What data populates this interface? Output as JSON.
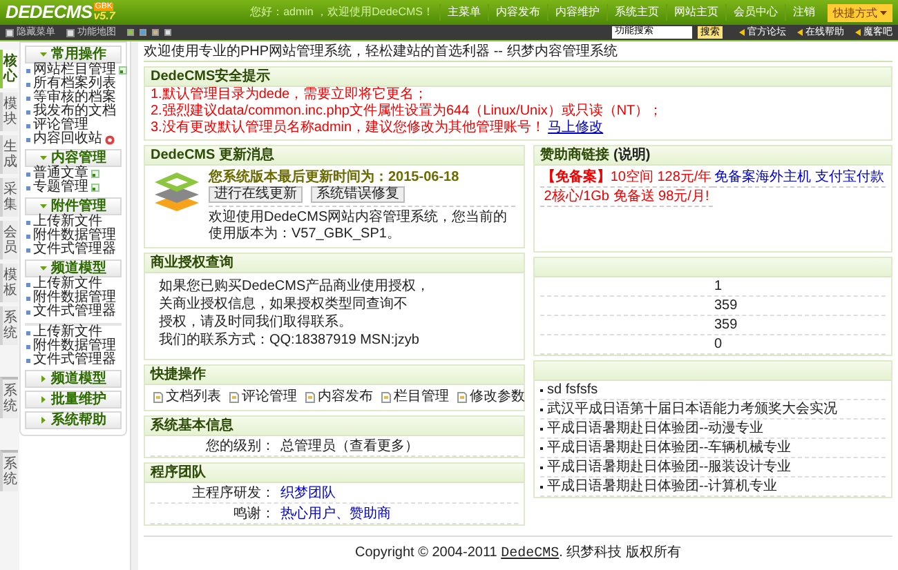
{
  "header": {
    "logo": "DEDECMS",
    "version": "v5.7",
    "edition": "GBK",
    "greeting": "您好：admin ，欢迎使用DedeCMS！",
    "nav": [
      "主菜单",
      "内容发布",
      "内容维护",
      "系统主页",
      "网站主页",
      "会员中心",
      "注销"
    ],
    "shortcut": "快捷方式"
  },
  "toolbar": {
    "hide_menu": "隐藏菜单",
    "feature_map": "功能地图",
    "skins": [
      {
        "color": "#8cc63f"
      },
      {
        "color": "#4fa3dc"
      },
      {
        "color": "#c9b48a"
      },
      {
        "color": "#e0e0e0"
      }
    ],
    "search": {
      "value": "功能搜索",
      "button": "搜索"
    },
    "links": [
      "官方论坛",
      "在线帮助",
      "魔客吧"
    ]
  },
  "side_tabs": [
    {
      "label": "核心",
      "selected": true,
      "separated": false
    },
    {
      "label": "模块",
      "selected": false,
      "separated": false
    },
    {
      "label": "生成",
      "selected": false,
      "separated": false
    },
    {
      "label": "采集",
      "selected": false,
      "separated": false
    },
    {
      "label": "会员",
      "selected": false,
      "separated": false
    },
    {
      "label": "模板",
      "selected": false,
      "separated": false
    },
    {
      "label": "系统",
      "selected": false,
      "separated": false
    },
    {
      "label": "系统",
      "selected": false,
      "separated": true
    },
    {
      "label": "系统",
      "selected": false,
      "separated": true
    }
  ],
  "menu": [
    {
      "title": "常用操作",
      "expanded": true,
      "items": [
        {
          "label": "网站栏目管理",
          "kind": "add"
        },
        {
          "label": "所有档案列表",
          "kind": "plain"
        },
        {
          "label": "等审核的档案",
          "kind": "plain"
        },
        {
          "label": "我发布的文档",
          "kind": "plain"
        },
        {
          "label": "评论管理",
          "kind": "plain"
        },
        {
          "label": "内容回收站",
          "kind": "trash"
        }
      ]
    },
    {
      "title": "内容管理",
      "expanded": true,
      "items": [
        {
          "label": "普通文章",
          "kind": "add"
        },
        {
          "label": "专题管理",
          "kind": "add"
        }
      ]
    },
    {
      "title": "附件管理",
      "expanded": true,
      "items": [
        {
          "label": "上传新文件",
          "kind": "plain"
        },
        {
          "label": "附件数据管理",
          "kind": "plain"
        },
        {
          "label": "文件式管理器",
          "kind": "plain"
        }
      ]
    },
    {
      "title": "频道模型",
      "expanded": true,
      "items": [
        {
          "label": "上传新文件",
          "kind": "plain"
        },
        {
          "label": "附件数据管理",
          "kind": "plain"
        },
        {
          "label": "文件式管理器",
          "kind": "plain"
        }
      ]
    },
    {
      "expanded": true,
      "items": [
        {
          "label": "上传新文件",
          "kind": "plain"
        },
        {
          "label": "附件数据管理",
          "kind": "plain"
        },
        {
          "label": "文件式管理器",
          "kind": "plain"
        }
      ]
    },
    {
      "title": "频道模型",
      "expanded": false
    },
    {
      "title": "批量维护",
      "expanded": false
    },
    {
      "title": "系统帮助",
      "expanded": false
    }
  ],
  "welcome": "欢迎使用专业的PHP网站管理系统，轻松建站的首选利器 -- 织梦内容管理系统",
  "security": {
    "title": "DedeCMS安全提示",
    "lines": [
      {
        "text": "1.默认管理目录为dede，需要立即将它更名；"
      },
      {
        "text": "2.强烈建议data/common.inc.php文件属性设置为644（Linux/Unix）或只读（NT）；"
      },
      {
        "text": "3.没有更改默认管理员名称admin，建议您修改为其他管理账号！",
        "link": "马上修改"
      }
    ]
  },
  "update": {
    "title": "DedeCMS 更新消息",
    "heading": "您系统版本最后更新时间为：2015-06-18",
    "buttons": [
      "进行在线更新",
      "系统错误修复"
    ],
    "text": "欢迎使用DedeCMS网站内容管理系统，您当前的使用版本为：V57_GBK_SP1。"
  },
  "license": {
    "title": "商业授权查询",
    "lines": [
      "如果您已购买DedeCMS产品商业使用授权，",
      "关商业授权信息，如果授权类型同查询不",
      "授权，请及时同我们取得联系。",
      "我们的联系方式：QQ:18387919 MSN:jzyb"
    ]
  },
  "quick": {
    "title": "快捷操作",
    "items": [
      "文档列表",
      "评论管理",
      "内容发布",
      "栏目管理",
      "修改参数"
    ]
  },
  "sysinfo": {
    "title": "系统基本信息",
    "rows": [
      {
        "label": "您的级别：",
        "value": "总管理员（查看更多）",
        "link": false
      }
    ]
  },
  "team": {
    "title": "程序团队",
    "rows": [
      {
        "label": "主程序研发：",
        "value": "织梦团队",
        "link": true
      },
      {
        "label": "鸣谢：",
        "value": "热心用户、赞助商",
        "link": true
      }
    ]
  },
  "sponsor": {
    "title": "赞助商链接",
    "note": "(说明)",
    "rows": [
      [
        {
          "text": "【免备案】",
          "color": "#ee0000",
          "bold": true
        },
        {
          "text": "10空间 128元/年",
          "color": "#ee0000",
          "bold": false
        },
        {
          "text": "免备案海外主机 支付宝付款",
          "color": "#0000cc",
          "bold": false
        }
      ],
      [
        {
          "text": "2核心/1Gb 免备送 98元/月!",
          "color": "#ee0000",
          "bold": false
        }
      ]
    ]
  },
  "stats": {
    "values": [
      "1",
      "359",
      "359",
      "0"
    ]
  },
  "news": {
    "items": [
      "sd fsfsfs",
      "武汉平成日语第十届日本语能力考颁奖大会实况",
      "平成日语暑期赴日体验团--动漫专业",
      "平成日语暑期赴日体验团--车辆机械专业",
      "平成日语暑期赴日体验团--服装设计专业",
      "平成日语暑期赴日体验团--计算机专业"
    ]
  },
  "footer": {
    "prefix": "Copyright © 2004-2011",
    "link": "DedeCMS",
    "suffix": ". 织梦科技 版权所有"
  }
}
